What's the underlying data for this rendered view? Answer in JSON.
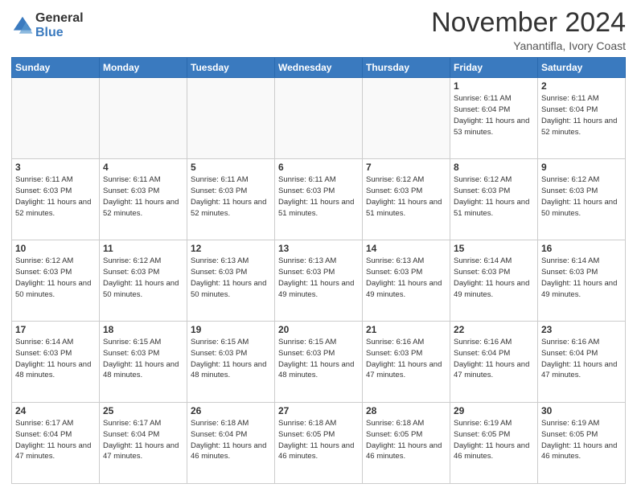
{
  "header": {
    "logo_line1": "General",
    "logo_line2": "Blue",
    "month_title": "November 2024",
    "subtitle": "Yanantifla, Ivory Coast"
  },
  "weekdays": [
    "Sunday",
    "Monday",
    "Tuesday",
    "Wednesday",
    "Thursday",
    "Friday",
    "Saturday"
  ],
  "weeks": [
    [
      {
        "day": "",
        "info": ""
      },
      {
        "day": "",
        "info": ""
      },
      {
        "day": "",
        "info": ""
      },
      {
        "day": "",
        "info": ""
      },
      {
        "day": "",
        "info": ""
      },
      {
        "day": "1",
        "info": "Sunrise: 6:11 AM\nSunset: 6:04 PM\nDaylight: 11 hours\nand 53 minutes."
      },
      {
        "day": "2",
        "info": "Sunrise: 6:11 AM\nSunset: 6:04 PM\nDaylight: 11 hours\nand 52 minutes."
      }
    ],
    [
      {
        "day": "3",
        "info": "Sunrise: 6:11 AM\nSunset: 6:03 PM\nDaylight: 11 hours\nand 52 minutes."
      },
      {
        "day": "4",
        "info": "Sunrise: 6:11 AM\nSunset: 6:03 PM\nDaylight: 11 hours\nand 52 minutes."
      },
      {
        "day": "5",
        "info": "Sunrise: 6:11 AM\nSunset: 6:03 PM\nDaylight: 11 hours\nand 52 minutes."
      },
      {
        "day": "6",
        "info": "Sunrise: 6:11 AM\nSunset: 6:03 PM\nDaylight: 11 hours\nand 51 minutes."
      },
      {
        "day": "7",
        "info": "Sunrise: 6:12 AM\nSunset: 6:03 PM\nDaylight: 11 hours\nand 51 minutes."
      },
      {
        "day": "8",
        "info": "Sunrise: 6:12 AM\nSunset: 6:03 PM\nDaylight: 11 hours\nand 51 minutes."
      },
      {
        "day": "9",
        "info": "Sunrise: 6:12 AM\nSunset: 6:03 PM\nDaylight: 11 hours\nand 50 minutes."
      }
    ],
    [
      {
        "day": "10",
        "info": "Sunrise: 6:12 AM\nSunset: 6:03 PM\nDaylight: 11 hours\nand 50 minutes."
      },
      {
        "day": "11",
        "info": "Sunrise: 6:12 AM\nSunset: 6:03 PM\nDaylight: 11 hours\nand 50 minutes."
      },
      {
        "day": "12",
        "info": "Sunrise: 6:13 AM\nSunset: 6:03 PM\nDaylight: 11 hours\nand 50 minutes."
      },
      {
        "day": "13",
        "info": "Sunrise: 6:13 AM\nSunset: 6:03 PM\nDaylight: 11 hours\nand 49 minutes."
      },
      {
        "day": "14",
        "info": "Sunrise: 6:13 AM\nSunset: 6:03 PM\nDaylight: 11 hours\nand 49 minutes."
      },
      {
        "day": "15",
        "info": "Sunrise: 6:14 AM\nSunset: 6:03 PM\nDaylight: 11 hours\nand 49 minutes."
      },
      {
        "day": "16",
        "info": "Sunrise: 6:14 AM\nSunset: 6:03 PM\nDaylight: 11 hours\nand 49 minutes."
      }
    ],
    [
      {
        "day": "17",
        "info": "Sunrise: 6:14 AM\nSunset: 6:03 PM\nDaylight: 11 hours\nand 48 minutes."
      },
      {
        "day": "18",
        "info": "Sunrise: 6:15 AM\nSunset: 6:03 PM\nDaylight: 11 hours\nand 48 minutes."
      },
      {
        "day": "19",
        "info": "Sunrise: 6:15 AM\nSunset: 6:03 PM\nDaylight: 11 hours\nand 48 minutes."
      },
      {
        "day": "20",
        "info": "Sunrise: 6:15 AM\nSunset: 6:03 PM\nDaylight: 11 hours\nand 48 minutes."
      },
      {
        "day": "21",
        "info": "Sunrise: 6:16 AM\nSunset: 6:03 PM\nDaylight: 11 hours\nand 47 minutes."
      },
      {
        "day": "22",
        "info": "Sunrise: 6:16 AM\nSunset: 6:04 PM\nDaylight: 11 hours\nand 47 minutes."
      },
      {
        "day": "23",
        "info": "Sunrise: 6:16 AM\nSunset: 6:04 PM\nDaylight: 11 hours\nand 47 minutes."
      }
    ],
    [
      {
        "day": "24",
        "info": "Sunrise: 6:17 AM\nSunset: 6:04 PM\nDaylight: 11 hours\nand 47 minutes."
      },
      {
        "day": "25",
        "info": "Sunrise: 6:17 AM\nSunset: 6:04 PM\nDaylight: 11 hours\nand 47 minutes."
      },
      {
        "day": "26",
        "info": "Sunrise: 6:18 AM\nSunset: 6:04 PM\nDaylight: 11 hours\nand 46 minutes."
      },
      {
        "day": "27",
        "info": "Sunrise: 6:18 AM\nSunset: 6:05 PM\nDaylight: 11 hours\nand 46 minutes."
      },
      {
        "day": "28",
        "info": "Sunrise: 6:18 AM\nSunset: 6:05 PM\nDaylight: 11 hours\nand 46 minutes."
      },
      {
        "day": "29",
        "info": "Sunrise: 6:19 AM\nSunset: 6:05 PM\nDaylight: 11 hours\nand 46 minutes."
      },
      {
        "day": "30",
        "info": "Sunrise: 6:19 AM\nSunset: 6:05 PM\nDaylight: 11 hours\nand 46 minutes."
      }
    ]
  ]
}
